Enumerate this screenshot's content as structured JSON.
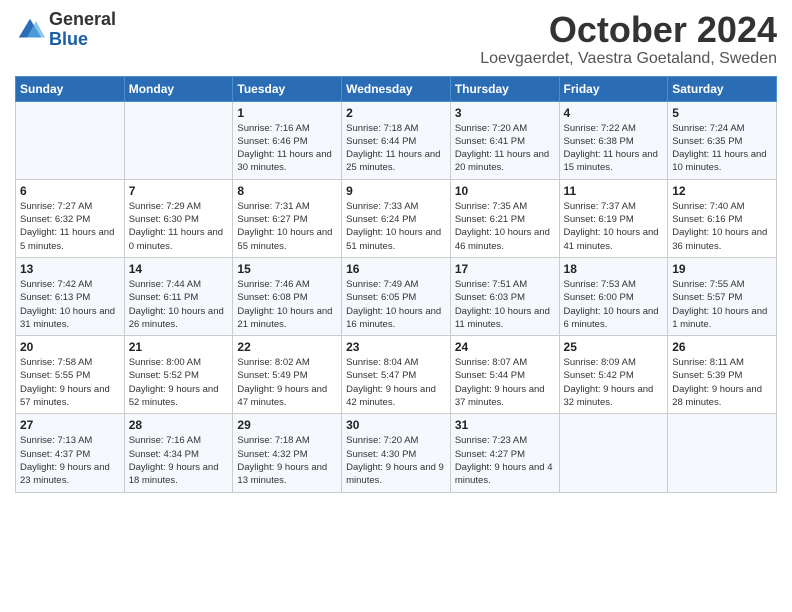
{
  "logo": {
    "general": "General",
    "blue": "Blue"
  },
  "title": {
    "month": "October 2024",
    "location": "Loevgaerdet, Vaestra Goetaland, Sweden"
  },
  "days_of_week": [
    "Sunday",
    "Monday",
    "Tuesday",
    "Wednesday",
    "Thursday",
    "Friday",
    "Saturday"
  ],
  "weeks": [
    [
      {
        "day": "",
        "info": ""
      },
      {
        "day": "",
        "info": ""
      },
      {
        "day": "1",
        "info": "Sunrise: 7:16 AM\nSunset: 6:46 PM\nDaylight: 11 hours and 30 minutes."
      },
      {
        "day": "2",
        "info": "Sunrise: 7:18 AM\nSunset: 6:44 PM\nDaylight: 11 hours and 25 minutes."
      },
      {
        "day": "3",
        "info": "Sunrise: 7:20 AM\nSunset: 6:41 PM\nDaylight: 11 hours and 20 minutes."
      },
      {
        "day": "4",
        "info": "Sunrise: 7:22 AM\nSunset: 6:38 PM\nDaylight: 11 hours and 15 minutes."
      },
      {
        "day": "5",
        "info": "Sunrise: 7:24 AM\nSunset: 6:35 PM\nDaylight: 11 hours and 10 minutes."
      }
    ],
    [
      {
        "day": "6",
        "info": "Sunrise: 7:27 AM\nSunset: 6:32 PM\nDaylight: 11 hours and 5 minutes."
      },
      {
        "day": "7",
        "info": "Sunrise: 7:29 AM\nSunset: 6:30 PM\nDaylight: 11 hours and 0 minutes."
      },
      {
        "day": "8",
        "info": "Sunrise: 7:31 AM\nSunset: 6:27 PM\nDaylight: 10 hours and 55 minutes."
      },
      {
        "day": "9",
        "info": "Sunrise: 7:33 AM\nSunset: 6:24 PM\nDaylight: 10 hours and 51 minutes."
      },
      {
        "day": "10",
        "info": "Sunrise: 7:35 AM\nSunset: 6:21 PM\nDaylight: 10 hours and 46 minutes."
      },
      {
        "day": "11",
        "info": "Sunrise: 7:37 AM\nSunset: 6:19 PM\nDaylight: 10 hours and 41 minutes."
      },
      {
        "day": "12",
        "info": "Sunrise: 7:40 AM\nSunset: 6:16 PM\nDaylight: 10 hours and 36 minutes."
      }
    ],
    [
      {
        "day": "13",
        "info": "Sunrise: 7:42 AM\nSunset: 6:13 PM\nDaylight: 10 hours and 31 minutes."
      },
      {
        "day": "14",
        "info": "Sunrise: 7:44 AM\nSunset: 6:11 PM\nDaylight: 10 hours and 26 minutes."
      },
      {
        "day": "15",
        "info": "Sunrise: 7:46 AM\nSunset: 6:08 PM\nDaylight: 10 hours and 21 minutes."
      },
      {
        "day": "16",
        "info": "Sunrise: 7:49 AM\nSunset: 6:05 PM\nDaylight: 10 hours and 16 minutes."
      },
      {
        "day": "17",
        "info": "Sunrise: 7:51 AM\nSunset: 6:03 PM\nDaylight: 10 hours and 11 minutes."
      },
      {
        "day": "18",
        "info": "Sunrise: 7:53 AM\nSunset: 6:00 PM\nDaylight: 10 hours and 6 minutes."
      },
      {
        "day": "19",
        "info": "Sunrise: 7:55 AM\nSunset: 5:57 PM\nDaylight: 10 hours and 1 minute."
      }
    ],
    [
      {
        "day": "20",
        "info": "Sunrise: 7:58 AM\nSunset: 5:55 PM\nDaylight: 9 hours and 57 minutes."
      },
      {
        "day": "21",
        "info": "Sunrise: 8:00 AM\nSunset: 5:52 PM\nDaylight: 9 hours and 52 minutes."
      },
      {
        "day": "22",
        "info": "Sunrise: 8:02 AM\nSunset: 5:49 PM\nDaylight: 9 hours and 47 minutes."
      },
      {
        "day": "23",
        "info": "Sunrise: 8:04 AM\nSunset: 5:47 PM\nDaylight: 9 hours and 42 minutes."
      },
      {
        "day": "24",
        "info": "Sunrise: 8:07 AM\nSunset: 5:44 PM\nDaylight: 9 hours and 37 minutes."
      },
      {
        "day": "25",
        "info": "Sunrise: 8:09 AM\nSunset: 5:42 PM\nDaylight: 9 hours and 32 minutes."
      },
      {
        "day": "26",
        "info": "Sunrise: 8:11 AM\nSunset: 5:39 PM\nDaylight: 9 hours and 28 minutes."
      }
    ],
    [
      {
        "day": "27",
        "info": "Sunrise: 7:13 AM\nSunset: 4:37 PM\nDaylight: 9 hours and 23 minutes."
      },
      {
        "day": "28",
        "info": "Sunrise: 7:16 AM\nSunset: 4:34 PM\nDaylight: 9 hours and 18 minutes."
      },
      {
        "day": "29",
        "info": "Sunrise: 7:18 AM\nSunset: 4:32 PM\nDaylight: 9 hours and 13 minutes."
      },
      {
        "day": "30",
        "info": "Sunrise: 7:20 AM\nSunset: 4:30 PM\nDaylight: 9 hours and 9 minutes."
      },
      {
        "day": "31",
        "info": "Sunrise: 7:23 AM\nSunset: 4:27 PM\nDaylight: 9 hours and 4 minutes."
      },
      {
        "day": "",
        "info": ""
      },
      {
        "day": "",
        "info": ""
      }
    ]
  ]
}
